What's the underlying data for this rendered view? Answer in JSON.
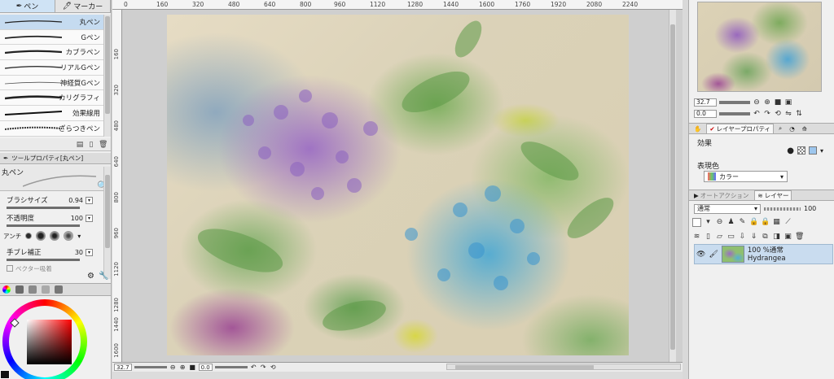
{
  "tool_tabs": {
    "pen": "ペン",
    "marker": "マーカー"
  },
  "brushes": [
    {
      "label": "丸ペン",
      "selected": true
    },
    {
      "label": "Gペン",
      "selected": false
    },
    {
      "label": "カブラペン",
      "selected": false
    },
    {
      "label": "リアルGペン",
      "selected": false
    },
    {
      "label": "神経質Gペン",
      "selected": false
    },
    {
      "label": "カリグラフィ",
      "selected": false
    },
    {
      "label": "効果線用",
      "selected": false
    },
    {
      "label": "ざらつきペン",
      "selected": false
    }
  ],
  "tool_property": {
    "header": "ツールプロパティ[丸ペン]",
    "preview_name": "丸ペン",
    "brush_size_label": "ブラシサイズ",
    "brush_size_value": "0.94",
    "opacity_label": "不透明度",
    "opacity_value": "100",
    "antialias_label": "アンチ",
    "stabilization_label": "手ブレ補正",
    "stabilization_value": "30",
    "vector_label": "ベクター吸着"
  },
  "canvas": {
    "ruler_h": [
      "0",
      "160",
      "320",
      "480",
      "640",
      "800",
      "960",
      "1120",
      "1280",
      "1440",
      "1600",
      "1760",
      "1920",
      "2080",
      "2240"
    ],
    "ruler_v": [
      "160",
      "320",
      "480",
      "640",
      "800",
      "960",
      "1120",
      "1280",
      "1440",
      "1600"
    ],
    "zoom": "32.7",
    "angle": "0.0"
  },
  "navigator": {
    "zoom": "32.7",
    "angle": "0.0"
  },
  "layer_property": {
    "tab_label": "レイヤープロパティ",
    "effect_label": "効果",
    "display_color_label": "表現色",
    "color_value": "カラー"
  },
  "layers_panel": {
    "tab_auto_action": "オートアクション",
    "tab_layer": "レイヤー",
    "blend_mode": "通常",
    "opacity": "100",
    "layer": {
      "line1": "100 %通常",
      "line2": "Hydrangea"
    }
  },
  "colors": {
    "accent_blue": "#c5dbf0",
    "layer_selected": "#c9dcef"
  }
}
